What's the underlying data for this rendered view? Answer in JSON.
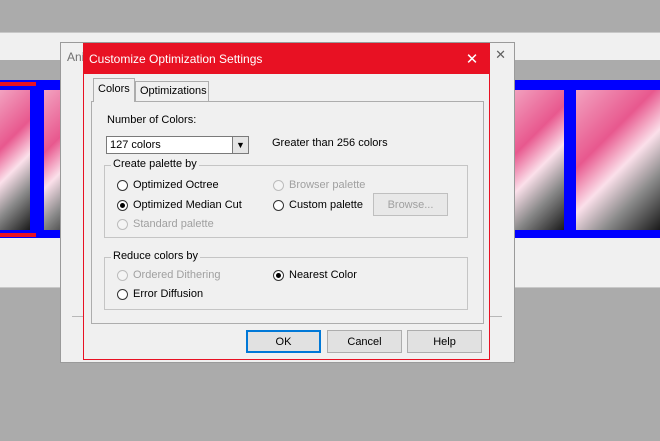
{
  "background": {
    "parent_title": "Ani",
    "parent_close": "✕"
  },
  "dialog": {
    "title": "Customize Optimization Settings",
    "close_glyph": "✕",
    "tabs": [
      {
        "label": "Colors",
        "selected": true
      },
      {
        "label": "Optimizations",
        "selected": false
      }
    ],
    "number_of_colors": {
      "label": "Number of Colors:",
      "value": "127 colors",
      "hint": "Greater than 256 colors"
    },
    "create_palette": {
      "title": "Create palette by",
      "options": [
        {
          "label": "Optimized Octree",
          "selected": false,
          "enabled": true
        },
        {
          "label": "Optimized Median Cut",
          "selected": true,
          "enabled": true
        },
        {
          "label": "Standard palette",
          "selected": false,
          "enabled": false
        },
        {
          "label": "Browser palette",
          "selected": false,
          "enabled": false
        },
        {
          "label": "Custom palette",
          "selected": false,
          "enabled": true
        }
      ],
      "browse_label": "Browse..."
    },
    "reduce_colors": {
      "title": "Reduce colors by",
      "options": [
        {
          "label": "Ordered Dithering",
          "selected": false,
          "enabled": false
        },
        {
          "label": "Error Diffusion",
          "selected": false,
          "enabled": true
        },
        {
          "label": "Nearest Color",
          "selected": true,
          "enabled": true
        }
      ]
    },
    "buttons": {
      "ok": "OK",
      "cancel": "Cancel",
      "help": "Help"
    }
  },
  "colors": {
    "title_bar": "#e81123",
    "film_strip": "#0000ff",
    "dialog_bg": "#f0f0f0"
  }
}
